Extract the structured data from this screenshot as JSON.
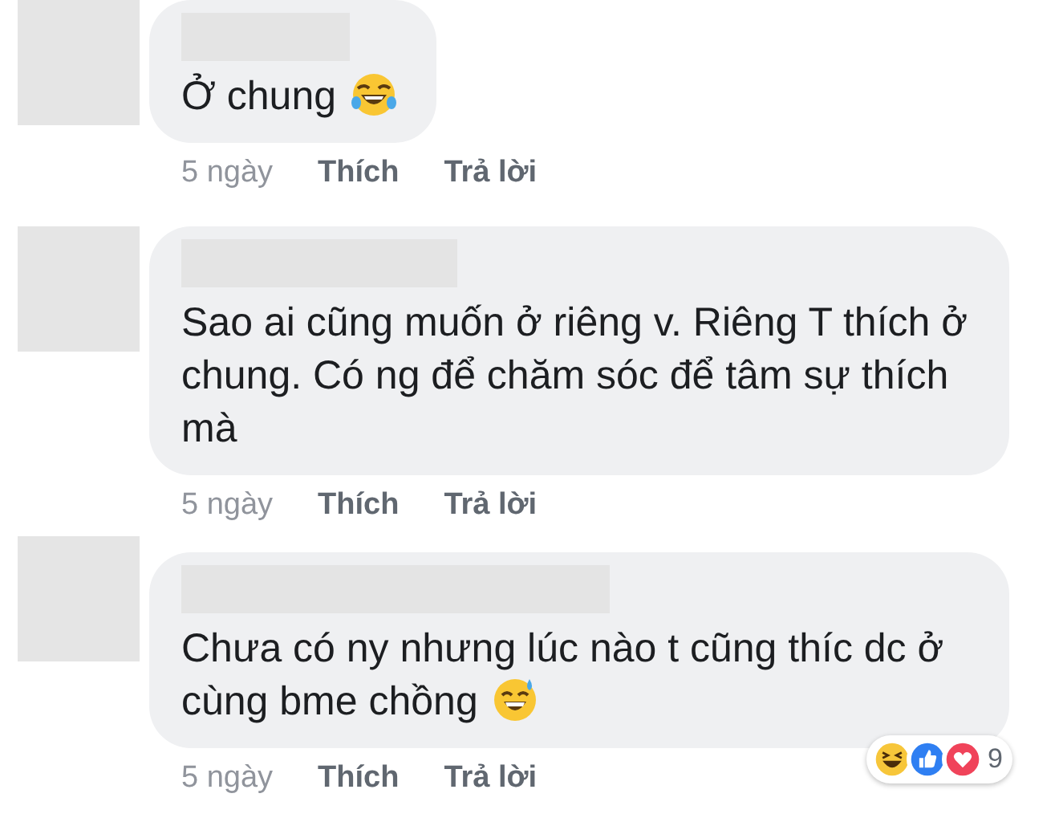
{
  "comments": [
    {
      "text": "Ở chung",
      "emoji": {
        "kind": "tears-of-joy"
      },
      "time": "5 ngày",
      "like": "Thích",
      "reply": "Trả lời"
    },
    {
      "text": "Sao ai cũng muốn ở riêng v. Riêng T thích ở chung. Có ng để chăm sóc để tâm sự thích mà",
      "time": "5 ngày",
      "like": "Thích",
      "reply": "Trả lời"
    },
    {
      "text": "Chưa có ny nhưng lúc nào t cũng thíc dc ở cùng bme chồng",
      "emoji": {
        "kind": "sweat-smile"
      },
      "time": "5 ngày",
      "like": "Thích",
      "reply": "Trả lời",
      "reactions": {
        "items": [
          {
            "kind": "haha"
          },
          {
            "kind": "like"
          },
          {
            "kind": "love"
          }
        ],
        "count": "9"
      }
    }
  ]
}
